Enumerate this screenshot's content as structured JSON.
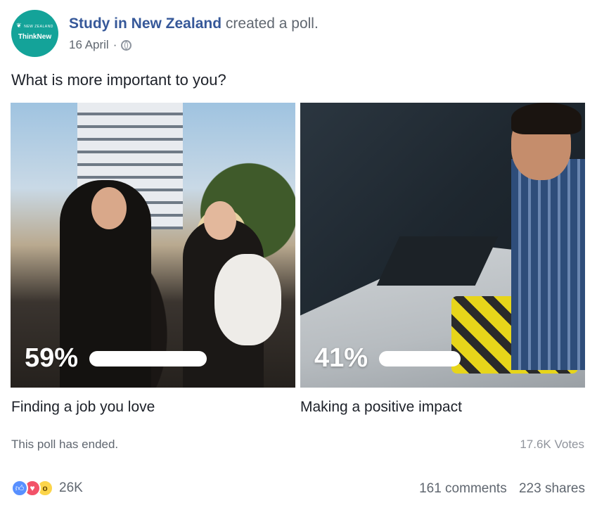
{
  "post": {
    "page_name": "Study in New Zealand",
    "action": "created a poll.",
    "date": "16 April",
    "separator": "·",
    "privacy_icon": "globe-icon",
    "avatar": {
      "logo_line": "NEW ZEALAND",
      "brand_a": "Think",
      "brand_b": "New",
      "color": "#14a399"
    },
    "question": "What is more important to you?"
  },
  "poll": {
    "options": [
      {
        "label": "Finding a job you love",
        "percent_text": "59%",
        "percent": 59
      },
      {
        "label": "Making a positive impact",
        "percent_text": "41%",
        "percent": 41
      }
    ],
    "status": "This poll has ended.",
    "votes": "17.6K Votes"
  },
  "footer": {
    "reaction_icons": [
      "like-icon",
      "love-icon",
      "wow-icon"
    ],
    "reaction_count": "26K",
    "comments": "161 comments",
    "shares": "223 shares"
  },
  "colors": {
    "link": "#365899",
    "secondary_text": "#606770",
    "like": "#5890ff",
    "love": "#f25268",
    "wow": "#fcd54a"
  }
}
